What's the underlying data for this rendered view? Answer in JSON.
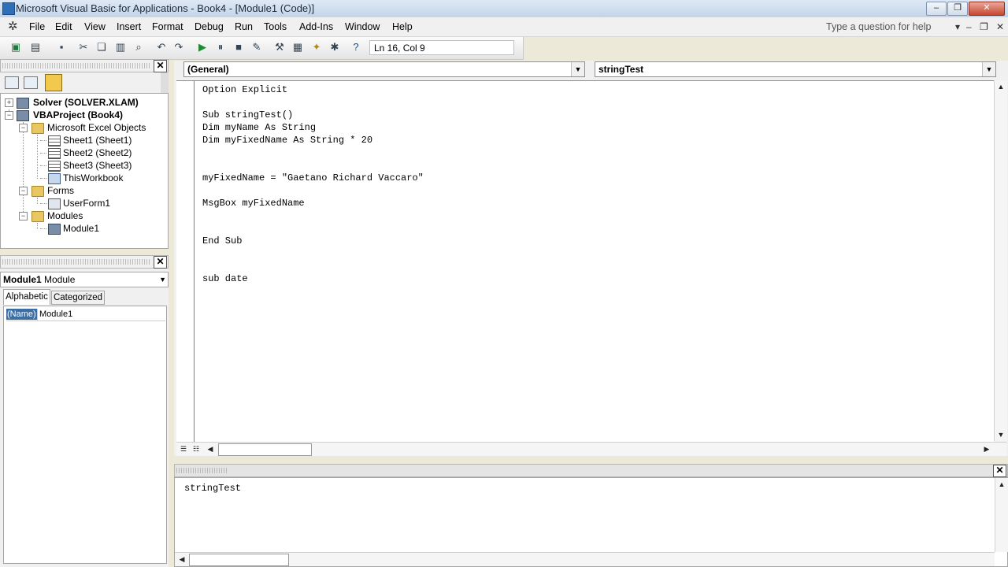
{
  "window": {
    "title": "Microsoft Visual Basic for Applications - Book4 - [Module1 (Code)]",
    "minimize_glyph": "–",
    "restore_glyph": "❐",
    "close_glyph": "✕"
  },
  "menu": {
    "items": [
      "File",
      "Edit",
      "View",
      "Insert",
      "Format",
      "Debug",
      "Run",
      "Tools",
      "Add-Ins",
      "Window",
      "Help"
    ],
    "help_placeholder": "Type a question for help",
    "mdi_buttons": [
      "▾",
      "–",
      "❐",
      "✕"
    ]
  },
  "toolbar": {
    "icons": [
      "excel-icon",
      "insert-userform-icon",
      "save-icon",
      "cut-icon",
      "copy-icon",
      "paste-icon",
      "find-icon",
      "undo-icon",
      "redo-icon",
      "run-icon",
      "break-icon",
      "reset-icon",
      "design-mode-icon",
      "project-explorer-icon",
      "properties-icon",
      "object-browser-icon",
      "toolbox-icon",
      "help-icon"
    ],
    "cursor_position": "Ln 16, Col 9"
  },
  "project_explorer": {
    "close": "✕",
    "tree": {
      "solver": "Solver (SOLVER.XLAM)",
      "vbaproject": "VBAProject (Book4)",
      "excel_objects": "Microsoft Excel Objects",
      "sheet1": "Sheet1 (Sheet1)",
      "sheet2": "Sheet2 (Sheet2)",
      "sheet3": "Sheet3 (Sheet3)",
      "thisworkbook": "ThisWorkbook",
      "forms": "Forms",
      "userform1": "UserForm1",
      "modules": "Modules",
      "module1": "Module1"
    },
    "expanders": {
      "solver": "+",
      "vbaproject": "−",
      "excel_objects": "−",
      "forms": "−",
      "modules": "−"
    }
  },
  "properties": {
    "close": "✕",
    "object_name": "Module1",
    "object_type": "Module",
    "tabs": [
      "Alphabetic",
      "Categorized"
    ],
    "rows": [
      {
        "name": "(Name)",
        "value": "Module1"
      }
    ]
  },
  "code": {
    "object_combo": "(General)",
    "procedure_combo": "stringTest",
    "lines": [
      "Option Explicit",
      "",
      "Sub stringTest()",
      "Dim myName As String",
      "Dim myFixedName As String * 20",
      "",
      "",
      "myFixedName = \"Gaetano Richard Vaccaro\"",
      "",
      "MsgBox myFixedName",
      "",
      "",
      "End Sub",
      "",
      "",
      "sub date"
    ]
  },
  "immediate": {
    "close": "✕",
    "text": "stringTest"
  }
}
